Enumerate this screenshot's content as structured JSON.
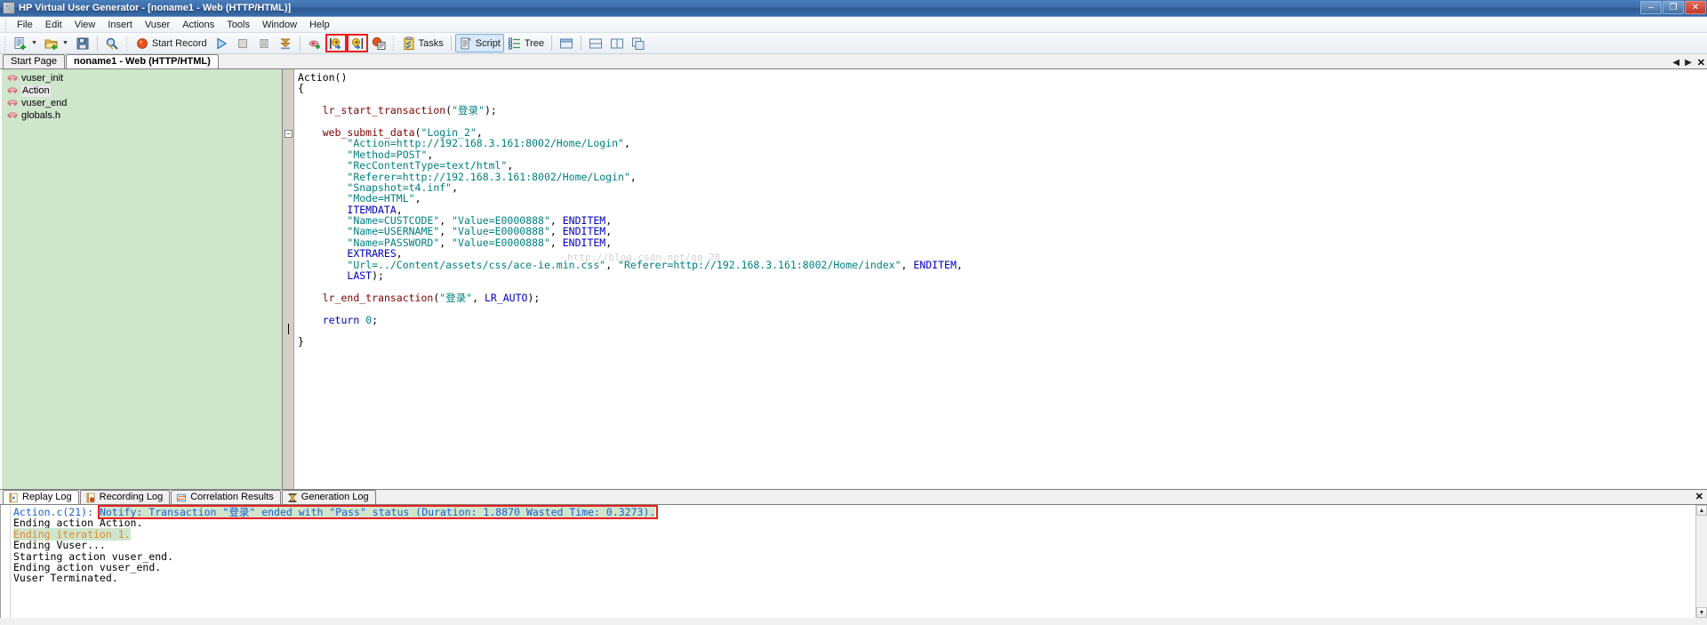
{
  "window": {
    "title": "HP Virtual User Generator - [noname1 - Web (HTTP/HTML)]",
    "app_icon": "vugen-icon",
    "minimize": "–",
    "maximize": "❐",
    "close": "✕"
  },
  "menubar": {
    "items": [
      {
        "label": "File"
      },
      {
        "label": "Edit"
      },
      {
        "label": "View"
      },
      {
        "label": "Insert"
      },
      {
        "label": "Vuser"
      },
      {
        "label": "Actions"
      },
      {
        "label": "Tools"
      },
      {
        "label": "Window"
      },
      {
        "label": "Help"
      }
    ]
  },
  "toolbar": {
    "new_label": "",
    "open_label": "",
    "save_label": "",
    "find_label": "",
    "start_record_label": "Start Record",
    "run_label": "",
    "stop_label": "",
    "pause_label": "",
    "download_label": "",
    "tree_add_label": "",
    "step_into_label": "",
    "step_out_label": "",
    "snapshot_label": "",
    "tasks_label": "Tasks",
    "script_label": "Script",
    "tree_label": "Tree",
    "icons": {
      "new": "new-script-icon",
      "open": "open-folder-icon",
      "save": "save-disk-icon",
      "find": "find-magnifier-icon",
      "record": "record-circle-icon",
      "run": "run-play-icon",
      "stop": "stop-square-icon",
      "pause": "pause-bars-icon",
      "download": "download-arrow-icon",
      "tree_add": "add-node-icon",
      "step_into": "step-into-icon",
      "step_out": "step-out-icon",
      "snapshot": "snapshot-icon",
      "tasks": "tasks-clipboard-icon",
      "script": "script-page-icon",
      "tree": "tree-view-icon"
    },
    "highlight_color": "#ee1c1c"
  },
  "doctabs": {
    "tabs": [
      {
        "label": "Start Page",
        "active": false
      },
      {
        "label": "noname1 - Web (HTTP/HTML)",
        "active": true
      }
    ],
    "nav_prev": "◀",
    "nav_next": "▶",
    "close": "✕"
  },
  "tree": {
    "icon": "brick-icon",
    "items": [
      {
        "label": "vuser_init",
        "selected": false
      },
      {
        "label": "Action",
        "selected": true
      },
      {
        "label": "vuser_end",
        "selected": false
      },
      {
        "label": "globals.h",
        "selected": false
      }
    ]
  },
  "editor": {
    "watermark": "http://blog.csdn.net/qq_28",
    "lines": [
      [
        {
          "t": "Action()",
          "c": "plain"
        }
      ],
      [
        {
          "t": "{",
          "c": "plain"
        }
      ],
      [
        {
          "t": "",
          "c": "plain"
        }
      ],
      [
        {
          "t": "    ",
          "c": "plain"
        },
        {
          "t": "lr_start_transaction",
          "c": "fn"
        },
        {
          "t": "(",
          "c": "plain"
        },
        {
          "t": "\"登录\"",
          "c": "str"
        },
        {
          "t": ");",
          "c": "plain"
        }
      ],
      [
        {
          "t": "",
          "c": "plain"
        }
      ],
      [
        {
          "t": "    ",
          "c": "plain"
        },
        {
          "t": "web_submit_data",
          "c": "fn"
        },
        {
          "t": "(",
          "c": "plain"
        },
        {
          "t": "\"Login_2\"",
          "c": "str"
        },
        {
          "t": ",",
          "c": "plain"
        }
      ],
      [
        {
          "t": "        ",
          "c": "plain"
        },
        {
          "t": "\"Action=http://192.168.3.161:8002/Home/Login\"",
          "c": "str"
        },
        {
          "t": ",",
          "c": "plain"
        }
      ],
      [
        {
          "t": "        ",
          "c": "plain"
        },
        {
          "t": "\"Method=POST\"",
          "c": "str"
        },
        {
          "t": ",",
          "c": "plain"
        }
      ],
      [
        {
          "t": "        ",
          "c": "plain"
        },
        {
          "t": "\"RecContentType=text/html\"",
          "c": "str"
        },
        {
          "t": ",",
          "c": "plain"
        }
      ],
      [
        {
          "t": "        ",
          "c": "plain"
        },
        {
          "t": "\"Referer=http://192.168.3.161:8002/Home/Login\"",
          "c": "str"
        },
        {
          "t": ",",
          "c": "plain"
        }
      ],
      [
        {
          "t": "        ",
          "c": "plain"
        },
        {
          "t": "\"Snapshot=t4.inf\"",
          "c": "str"
        },
        {
          "t": ",",
          "c": "plain"
        }
      ],
      [
        {
          "t": "        ",
          "c": "plain"
        },
        {
          "t": "\"Mode=HTML\"",
          "c": "str"
        },
        {
          "t": ",",
          "c": "plain"
        }
      ],
      [
        {
          "t": "        ",
          "c": "plain"
        },
        {
          "t": "ITEMDATA",
          "c": "kw"
        },
        {
          "t": ",",
          "c": "plain"
        }
      ],
      [
        {
          "t": "        ",
          "c": "plain"
        },
        {
          "t": "\"Name=CUSTCODE\"",
          "c": "str"
        },
        {
          "t": ", ",
          "c": "plain"
        },
        {
          "t": "\"Value=E0000888\"",
          "c": "str"
        },
        {
          "t": ", ",
          "c": "plain"
        },
        {
          "t": "ENDITEM",
          "c": "kw"
        },
        {
          "t": ",",
          "c": "plain"
        }
      ],
      [
        {
          "t": "        ",
          "c": "plain"
        },
        {
          "t": "\"Name=USERNAME\"",
          "c": "str"
        },
        {
          "t": ", ",
          "c": "plain"
        },
        {
          "t": "\"Value=E0000888\"",
          "c": "str"
        },
        {
          "t": ", ",
          "c": "plain"
        },
        {
          "t": "ENDITEM",
          "c": "kw"
        },
        {
          "t": ",",
          "c": "plain"
        }
      ],
      [
        {
          "t": "        ",
          "c": "plain"
        },
        {
          "t": "\"Name=PASSWORD\"",
          "c": "str"
        },
        {
          "t": ", ",
          "c": "plain"
        },
        {
          "t": "\"Value=E0000888\"",
          "c": "str"
        },
        {
          "t": ", ",
          "c": "plain"
        },
        {
          "t": "ENDITEM",
          "c": "kw"
        },
        {
          "t": ",",
          "c": "plain"
        }
      ],
      [
        {
          "t": "        ",
          "c": "plain"
        },
        {
          "t": "EXTRARES",
          "c": "kw"
        },
        {
          "t": ",",
          "c": "plain"
        }
      ],
      [
        {
          "t": "        ",
          "c": "plain"
        },
        {
          "t": "\"Url=../Content/assets/css/ace-ie.min.css\"",
          "c": "str"
        },
        {
          "t": ", ",
          "c": "plain"
        },
        {
          "t": "\"Referer=http://192.168.3.161:8002/Home/index\"",
          "c": "str"
        },
        {
          "t": ", ",
          "c": "plain"
        },
        {
          "t": "ENDITEM",
          "c": "kw"
        },
        {
          "t": ",",
          "c": "plain"
        }
      ],
      [
        {
          "t": "        ",
          "c": "plain"
        },
        {
          "t": "LAST",
          "c": "kw"
        },
        {
          "t": ");",
          "c": "plain"
        }
      ],
      [
        {
          "t": "",
          "c": "plain"
        }
      ],
      [
        {
          "t": "    ",
          "c": "plain"
        },
        {
          "t": "lr_end_transaction",
          "c": "fn"
        },
        {
          "t": "(",
          "c": "plain"
        },
        {
          "t": "\"登录\"",
          "c": "str"
        },
        {
          "t": ", ",
          "c": "plain"
        },
        {
          "t": "LR_AUTO",
          "c": "kw"
        },
        {
          "t": ");",
          "c": "plain"
        }
      ],
      [
        {
          "t": "",
          "c": "plain"
        }
      ],
      [
        {
          "t": "    ",
          "c": "plain"
        },
        {
          "t": "return",
          "c": "kw"
        },
        {
          "t": " ",
          "c": "plain"
        },
        {
          "t": "0",
          "c": "num"
        },
        {
          "t": ";",
          "c": "plain"
        }
      ],
      [
        {
          "t": "",
          "c": "plain"
        }
      ],
      [
        {
          "t": "}",
          "c": "plain"
        }
      ]
    ]
  },
  "log": {
    "tabs": [
      {
        "label": "Replay Log",
        "icon": "replay-log-icon",
        "active": true
      },
      {
        "label": "Recording Log",
        "icon": "recording-log-icon",
        "active": false
      },
      {
        "label": "Correlation Results",
        "icon": "correlation-results-icon",
        "active": false
      },
      {
        "label": "Generation Log",
        "icon": "generation-log-icon",
        "active": false
      }
    ],
    "close": "✕",
    "lines": [
      {
        "prefix": "Action.c(21): ",
        "prefix_class": "blue",
        "text": "Notify: Transaction \"登录\" ended with \"Pass\" status (Duration: 1.8870 Wasted Time: 0.3273).",
        "text_class": "hl",
        "boxed": true
      },
      {
        "prefix": "",
        "prefix_class": "black",
        "text": "Ending action Action.",
        "text_class": "black",
        "boxed": false
      },
      {
        "prefix": "",
        "prefix_class": "black",
        "text": "Ending iteration 1.",
        "text_class": "orange",
        "boxed": false
      },
      {
        "prefix": "",
        "prefix_class": "black",
        "text": "Ending Vuser...",
        "text_class": "black",
        "boxed": false
      },
      {
        "prefix": "",
        "prefix_class": "black",
        "text": "Starting action vuser_end.",
        "text_class": "black",
        "boxed": false
      },
      {
        "prefix": "",
        "prefix_class": "black",
        "text": "Ending action vuser_end.",
        "text_class": "black",
        "boxed": false
      },
      {
        "prefix": "",
        "prefix_class": "black",
        "text": "Vuser Terminated.",
        "text_class": "black",
        "boxed": false
      }
    ]
  },
  "colors": {
    "title_blue": "#3c6ca8",
    "tree_green": "#cfe5cc",
    "highlight_red": "#ee1c1c",
    "keyword_blue": "#0000c0",
    "string_teal": "#008080",
    "function_maroon": "#800000",
    "log_blue": "#1b5ed6",
    "log_orange": "#e08a30"
  }
}
